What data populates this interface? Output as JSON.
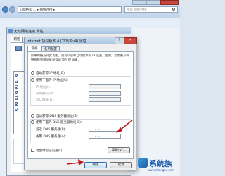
{
  "explorer": {
    "breadcrumb": "« 网络和 ... ▸ 网络连接 ▸",
    "search_placeholder": "搜索 网络连接"
  },
  "status_window": {
    "title": "无线网络连接 属性",
    "tab_label": "网络",
    "close_glyph": "✕"
  },
  "ipv4_dialog": {
    "title": "Internet 协议版本 4 (TCP/IPv4) 属性",
    "help_glyph": "?",
    "close_glyph": "✕",
    "tabs": [
      "常规",
      "备用配置"
    ],
    "description": "如果网络支持此功能，则可以获取自动指派的 IP 设置。否则，您需要从网络系统管理员处获得适当的 IP 设置。",
    "ip_auto": "自动获得 IP 地址(O)",
    "ip_manual": "使用下面的 IP 地址(S):",
    "ip_address_label": "IP 地址(I):",
    "subnet_label": "子网掩码(U):",
    "gateway_label": "默认网关(D):",
    "dns_auto": "自动获得 DNS 服务器地址(B)",
    "dns_manual": "使用下面的 DNS 服务器地址(E):",
    "preferred_dns_label": "首选 DNS 服务器(P):",
    "alternate_dns_label": "备用 DNS 服务器(A):",
    "preferred_dns_value": ".     .     .",
    "alternate_dns_value": ".     .     .",
    "validate_label": "退出时验证设置(L)",
    "advanced_button": "高级(V)...",
    "ok_button": "确定",
    "cancel_button": "取消"
  },
  "watermark": {
    "text": "系统族",
    "url": "www.xitongzu.com"
  },
  "colors": {
    "arrow": "#c0171d",
    "accent": "#2b6fb5"
  }
}
